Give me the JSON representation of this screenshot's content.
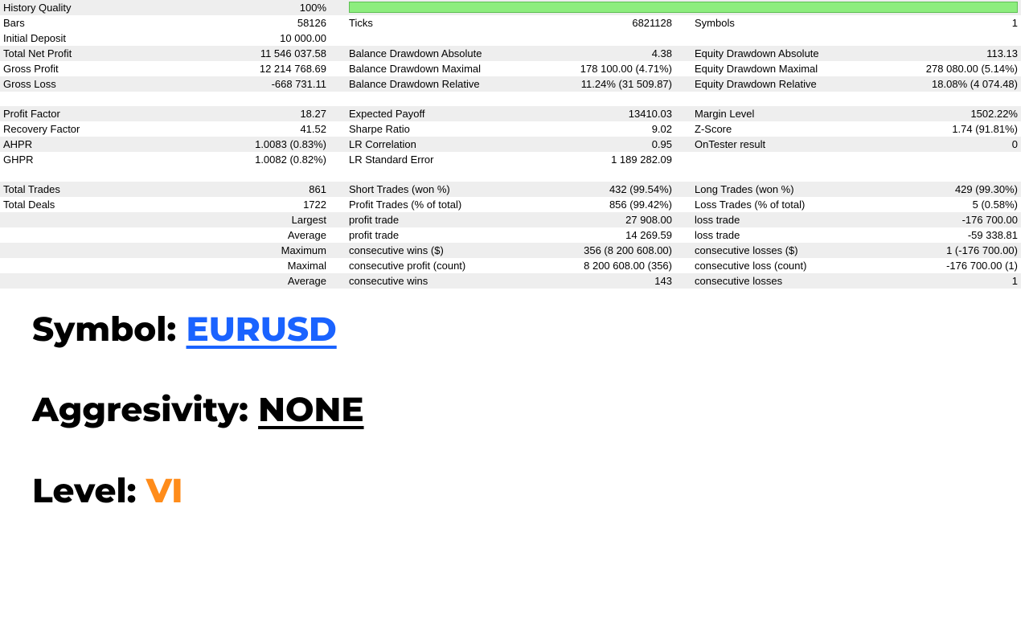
{
  "rows": [
    {
      "alt": true,
      "c1l": "History Quality",
      "c1v": "100%",
      "qbar": true
    },
    {
      "alt": false,
      "c1l": "Bars",
      "c1v": "58126",
      "c2l": "Ticks",
      "c2v": "6821128",
      "c3l": "Symbols",
      "c3v": "1"
    },
    {
      "alt": false,
      "c1l": "Initial Deposit",
      "c1v": "10 000.00",
      "c2l": "",
      "c2v": "",
      "c3l": "",
      "c3v": ""
    },
    {
      "alt": true,
      "c1l": "Total Net Profit",
      "c1v": "11 546 037.58",
      "c2l": "Balance Drawdown Absolute",
      "c2v": "4.38",
      "c3l": "Equity Drawdown Absolute",
      "c3v": "113.13"
    },
    {
      "alt": false,
      "c1l": "Gross Profit",
      "c1v": "12 214 768.69",
      "c2l": "Balance Drawdown Maximal",
      "c2v": "178 100.00 (4.71%)",
      "c3l": "Equity Drawdown Maximal",
      "c3v": "278 080.00 (5.14%)"
    },
    {
      "alt": true,
      "c1l": "Gross Loss",
      "c1v": "-668 731.11",
      "c2l": "Balance Drawdown Relative",
      "c2v": "11.24% (31 509.87)",
      "c3l": "Equity Drawdown Relative",
      "c3v": "18.08% (4 074.48)"
    },
    {
      "gap": true
    },
    {
      "alt": true,
      "c1l": "Profit Factor",
      "c1v": "18.27",
      "c2l": "Expected Payoff",
      "c2v": "13410.03",
      "c3l": "Margin Level",
      "c3v": "1502.22%"
    },
    {
      "alt": false,
      "c1l": "Recovery Factor",
      "c1v": "41.52",
      "c2l": "Sharpe Ratio",
      "c2v": "9.02",
      "c3l": "Z-Score",
      "c3v": "1.74 (91.81%)"
    },
    {
      "alt": true,
      "c1l": "AHPR",
      "c1v": "1.0083 (0.83%)",
      "c2l": "LR Correlation",
      "c2v": "0.95",
      "c3l": "OnTester result",
      "c3v": "0"
    },
    {
      "alt": false,
      "c1l": "GHPR",
      "c1v": "1.0082 (0.82%)",
      "c2l": "LR Standard Error",
      "c2v": "1 189 282.09",
      "c3l": "",
      "c3v": ""
    },
    {
      "gap": true
    },
    {
      "alt": true,
      "c1l": "Total Trades",
      "c1v": "861",
      "c2l": "Short Trades (won %)",
      "c2v": "432 (99.54%)",
      "c3l": "Long Trades (won %)",
      "c3v": "429 (99.30%)"
    },
    {
      "alt": false,
      "c1l": "Total Deals",
      "c1v": "1722",
      "c2l": "Profit Trades (% of total)",
      "c2v": "856 (99.42%)",
      "c3l": "Loss Trades (% of total)",
      "c3v": "5 (0.58%)"
    },
    {
      "alt": true,
      "c1l": "",
      "c1v": "Largest",
      "c2l": "profit trade",
      "c2v": "27 908.00",
      "c3l": "loss trade",
      "c3v": "-176 700.00"
    },
    {
      "alt": false,
      "c1l": "",
      "c1v": "Average",
      "c2l": "profit trade",
      "c2v": "14 269.59",
      "c3l": "loss trade",
      "c3v": "-59 338.81"
    },
    {
      "alt": true,
      "c1l": "",
      "c1v": "Maximum",
      "c2l": "consecutive wins ($)",
      "c2v": "356 (8 200 608.00)",
      "c3l": "consecutive losses ($)",
      "c3v": "1 (-176 700.00)"
    },
    {
      "alt": false,
      "c1l": "",
      "c1v": "Maximal",
      "c2l": "consecutive profit (count)",
      "c2v": "8 200 608.00 (356)",
      "c3l": "consecutive loss (count)",
      "c3v": "-176 700.00 (1)"
    },
    {
      "alt": true,
      "c1l": "",
      "c1v": "Average",
      "c2l": "consecutive wins",
      "c2v": "143",
      "c3l": "consecutive losses",
      "c3v": "1"
    }
  ],
  "titles": {
    "symbol_label": "Symbol: ",
    "symbol_value": "EURUSD",
    "aggr_label": "Aggresivity: ",
    "aggr_value": "NONE",
    "level_label": "Level: ",
    "level_value": "VI"
  }
}
